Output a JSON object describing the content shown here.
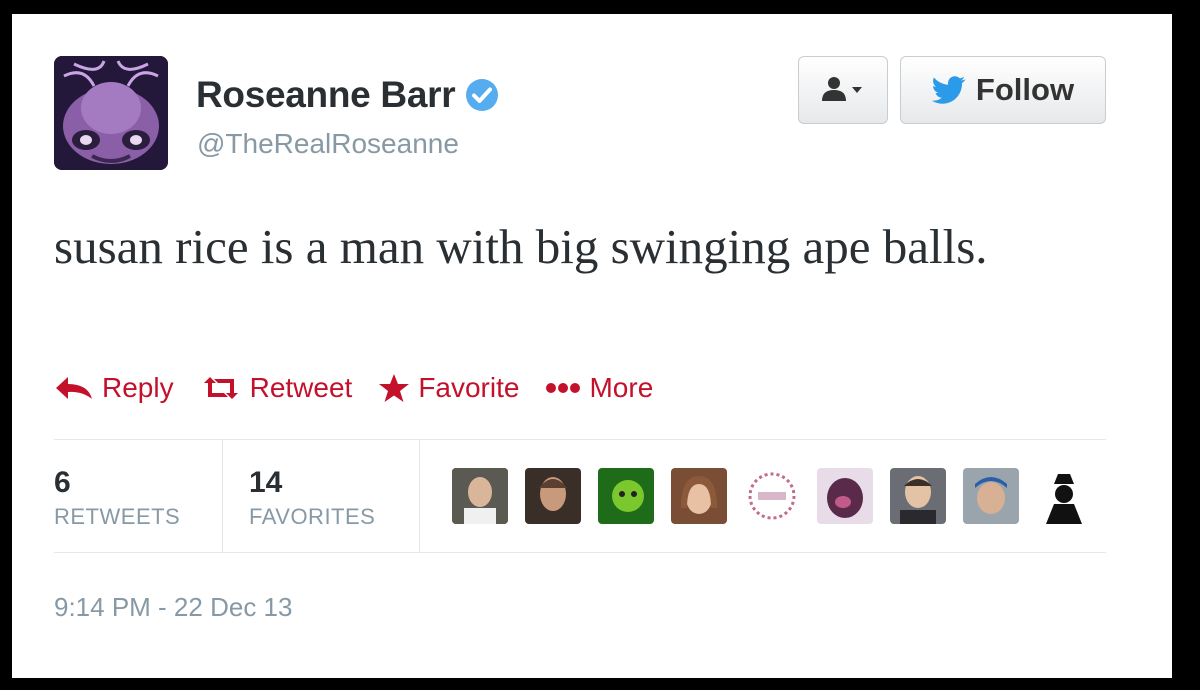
{
  "profile": {
    "display_name": "Roseanne Barr",
    "handle": "@TheRealRoseanne"
  },
  "header_buttons": {
    "follow_label": "Follow"
  },
  "tweet": {
    "text": "susan rice is a man with big swinging ape balls.",
    "timestamp": "9:14 PM - 22 Dec 13"
  },
  "actions": {
    "reply": "Reply",
    "retweet": "Retweet",
    "favorite": "Favorite",
    "more": "More"
  },
  "stats": {
    "retweets_count": "6",
    "retweets_label": "RETWEETS",
    "favorites_count": "14",
    "favorites_label": "FAVORITES"
  },
  "favoriters_count": 9,
  "colors": {
    "action_red": "#c4112b",
    "verified_blue": "#55acee",
    "follow_bird": "#2b9ae8"
  }
}
